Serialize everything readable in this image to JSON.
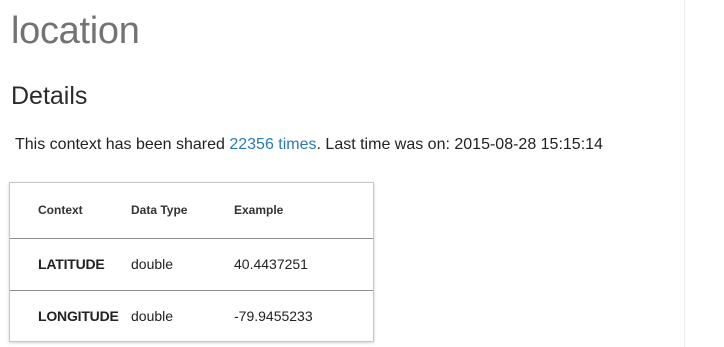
{
  "header": {
    "title": "location",
    "section_title": "Details"
  },
  "share_info": {
    "prefix": "This context has been shared ",
    "count_link": "22356 times",
    "suffix": ".  Last time was on: 2015-08-28 15:15:14"
  },
  "table": {
    "columns": [
      "Context",
      "Data Type",
      "Example"
    ],
    "rows": [
      {
        "context": "LATITUDE",
        "data_type": "double",
        "example": "40.4437251"
      },
      {
        "context": "LONGITUDE",
        "data_type": "double",
        "example": "-79.9455233"
      }
    ]
  },
  "colors": {
    "link": "#2a7ab5",
    "title": "#737373"
  }
}
